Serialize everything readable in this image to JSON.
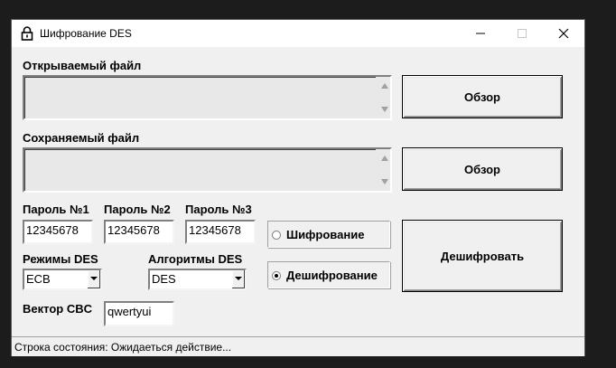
{
  "window": {
    "title": "Шифрование DES"
  },
  "source_file": {
    "label": "Открываемый файл",
    "value": "",
    "browse_label": "Обзор"
  },
  "target_file": {
    "label": "Сохраняемый файл",
    "value": "",
    "browse_label": "Обзор"
  },
  "passwords": [
    {
      "label": "Пароль №1",
      "value": "12345678"
    },
    {
      "label": "Пароль №2",
      "value": "12345678"
    },
    {
      "label": "Пароль №3",
      "value": "12345678"
    }
  ],
  "mode": {
    "label": "Режимы DES",
    "selected": "ECB"
  },
  "algorithm": {
    "label": "Алгоритмы DES",
    "selected": "DES"
  },
  "vector": {
    "label": "Вектор CBC",
    "value": "qwertyui"
  },
  "operation": {
    "options": [
      {
        "label": "Шифрование",
        "checked": false
      },
      {
        "label": "Дешифрование",
        "checked": true
      }
    ],
    "action_label": "Дешифровать"
  },
  "status": {
    "text": "Строка состояния: Ожидаеться действие..."
  }
}
